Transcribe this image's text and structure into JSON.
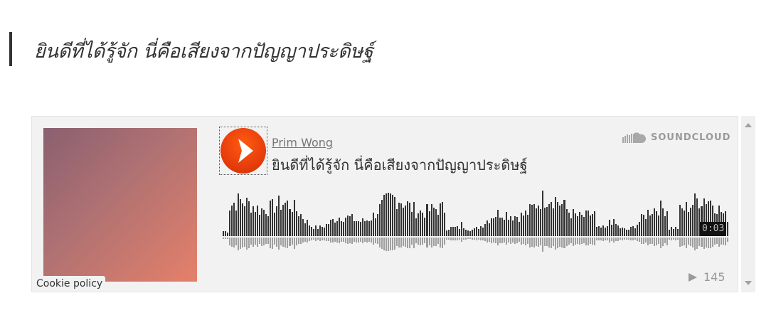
{
  "heading": {
    "text": "ยินดีที่ได้รู้จัก นี่คือเสียงจากปัญญาประดิษฐ์"
  },
  "player": {
    "artist": "Prim Wong",
    "track_title": "ยินดีที่ได้รู้จัก นี่คือเสียงจากปัญญาประดิษฐ์",
    "brand": "SOUNDCLOUD",
    "duration": "0:03",
    "play_count": "145",
    "cookie_policy": "Cookie policy",
    "play_icon": "play-icon",
    "colors": {
      "accent": "#f23d0c",
      "waveform": "#333333",
      "waveform_reflection": "#8a8a8a",
      "muted_text": "#999999"
    }
  }
}
